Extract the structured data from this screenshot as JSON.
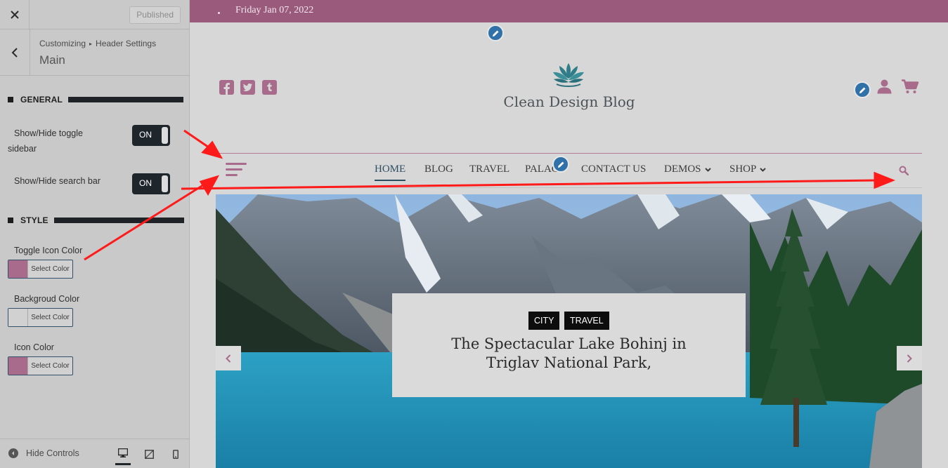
{
  "sidebar": {
    "close_label": "×",
    "publish_label": "Published",
    "breadcrumb": {
      "root": "Customizing",
      "separator": "▸",
      "parent": "Header Settings"
    },
    "section_title": "Main",
    "general_heading": "GENERAL",
    "toggle_sidebar": {
      "label_line1": "Show/Hide toggle",
      "label_line2": "sidebar",
      "state": "ON"
    },
    "toggle_search": {
      "label": "Show/Hide search bar",
      "state": "ON"
    },
    "style_heading": "STYLE",
    "toggle_icon_color": {
      "label": "Toggle Icon Color",
      "button": "Select Color",
      "value": "#a86b8b"
    },
    "background_color": {
      "label": "Backgroud Color",
      "button": "Select Color",
      "value": "#d1d1d1"
    },
    "icon_color": {
      "label": "Icon Color",
      "button": "Select Color",
      "value": "#a86b8b"
    },
    "footer": {
      "hide_controls": "Hide Controls"
    }
  },
  "preview": {
    "topbar": {
      "date": "Friday Jan 07, 2022",
      "color": "#9a5a7c"
    },
    "social_icons": [
      "facebook-icon",
      "twitter-icon",
      "tumblr-icon"
    ],
    "site_title": "Clean Design Blog",
    "accent_color": "#a86b8b",
    "nav": {
      "items": [
        {
          "label": "HOME",
          "active": true
        },
        {
          "label": "BLOG"
        },
        {
          "label": "TRAVEL"
        },
        {
          "label": "PALACE"
        },
        {
          "label": "CONTACT US"
        },
        {
          "label": "DEMOS",
          "dropdown": true
        },
        {
          "label": "SHOP",
          "dropdown": true
        }
      ]
    },
    "slide": {
      "tags": [
        "CITY",
        "TRAVEL"
      ],
      "title_line1": "The Spectacular Lake Bohinj in",
      "title_line2": "Triglav National Park,"
    }
  }
}
